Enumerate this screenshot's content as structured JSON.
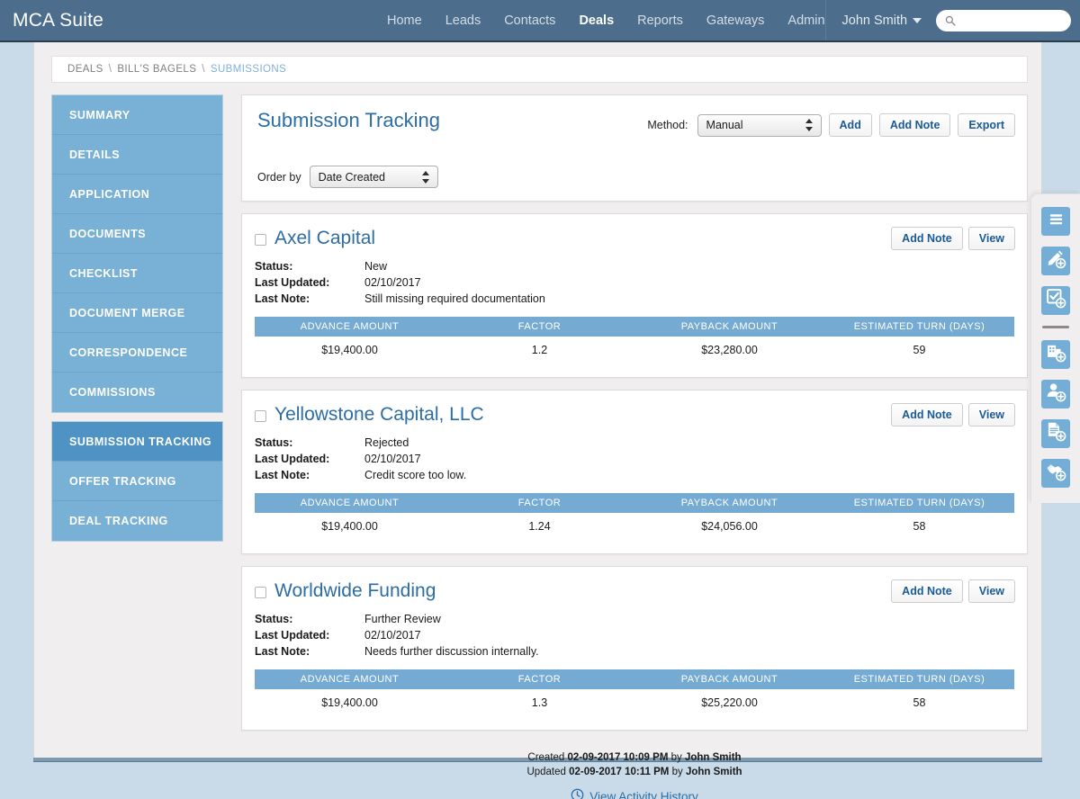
{
  "topbar": {
    "brand": "MCA Suite",
    "nav": [
      {
        "label": "Home",
        "active": false
      },
      {
        "label": "Leads",
        "active": false
      },
      {
        "label": "Contacts",
        "active": false
      },
      {
        "label": "Deals",
        "active": true
      },
      {
        "label": "Reports",
        "active": false
      },
      {
        "label": "Gateways",
        "active": false
      },
      {
        "label": "Admin",
        "active": false
      }
    ],
    "user_name": "John Smith",
    "search_value": "",
    "search_placeholder": "",
    "bar_color": "#4c6e8c"
  },
  "breadcrumb": {
    "items": [
      "DEALS",
      "BILL'S BAGELS",
      "SUBMISSIONS"
    ],
    "separator": "\\",
    "current_index": 2
  },
  "sidebar": {
    "group1": [
      {
        "label": "SUMMARY"
      },
      {
        "label": "DETAILS"
      },
      {
        "label": "APPLICATION"
      },
      {
        "label": "DOCUMENTS"
      },
      {
        "label": "CHECKLIST"
      },
      {
        "label": "DOCUMENT MERGE"
      },
      {
        "label": "CORRESPONDENCE"
      },
      {
        "label": "COMMISSIONS"
      }
    ],
    "group2": [
      {
        "label": "SUBMISSION TRACKING",
        "active": true
      },
      {
        "label": "OFFER TRACKING",
        "active": false
      },
      {
        "label": "DEAL TRACKING",
        "active": false
      }
    ],
    "active_color": "#4e93c4",
    "base_color": "#79b1d6"
  },
  "header": {
    "title": "Submission Tracking",
    "method_label": "Method:",
    "method_value": "Manual",
    "add_label": "Add",
    "add_note_label": "Add Note",
    "export_label": "Export",
    "order_by_label": "Order by",
    "order_by_value": "Date Created"
  },
  "table_headers": [
    "ADVANCE AMOUNT",
    "FACTOR",
    "PAYBACK AMOUNT",
    "ESTIMATED TURN (DAYS)"
  ],
  "card_labels": {
    "status": "Status:",
    "last_updated": "Last Updated:",
    "last_note": "Last Note:",
    "add_note": "Add Note",
    "view": "View"
  },
  "submissions": [
    {
      "name": "Axel Capital",
      "status": "New",
      "last_updated": "02/10/2017",
      "last_note": "Still missing required documentation",
      "advance_amount": "$19,400.00",
      "factor": "1.2",
      "payback_amount": "$23,280.00",
      "estimated_turn": "59"
    },
    {
      "name": "Yellowstone Capital, LLC",
      "status": "Rejected",
      "last_updated": "02/10/2017",
      "last_note": "Credit score too low.",
      "advance_amount": "$19,400.00",
      "factor": "1.24",
      "payback_amount": "$24,056.00",
      "estimated_turn": "58"
    },
    {
      "name": "Worldwide Funding",
      "status": "Further Review",
      "last_updated": "02/10/2017",
      "last_note": "Needs further discussion internally.",
      "advance_amount": "$19,400.00",
      "factor": "1.3",
      "payback_amount": "$25,220.00",
      "estimated_turn": "58"
    }
  ],
  "footer": {
    "created_prefix": "Created",
    "created_timestamp": "02-09-2017 10:09 PM",
    "created_by_prefix": "by",
    "created_by": "John Smith",
    "updated_prefix": "Updated",
    "updated_timestamp": "02-09-2017 10:11 PM",
    "updated_by_prefix": "by",
    "updated_by": "John Smith",
    "activity_link": "View Activity History"
  },
  "right_toolbar": {
    "items": [
      {
        "icon": "menu-list-icon",
        "name": "menu-toggle"
      },
      {
        "icon": "add-note-icon",
        "name": "add-note"
      },
      {
        "icon": "add-task-icon",
        "name": "add-task"
      },
      {
        "icon": "add-company-icon",
        "name": "add-company"
      },
      {
        "icon": "add-contact-icon",
        "name": "add-contact"
      },
      {
        "icon": "add-document-icon",
        "name": "add-document"
      },
      {
        "icon": "add-deal-icon",
        "name": "add-deal"
      }
    ],
    "button_color": "#74aed6"
  }
}
